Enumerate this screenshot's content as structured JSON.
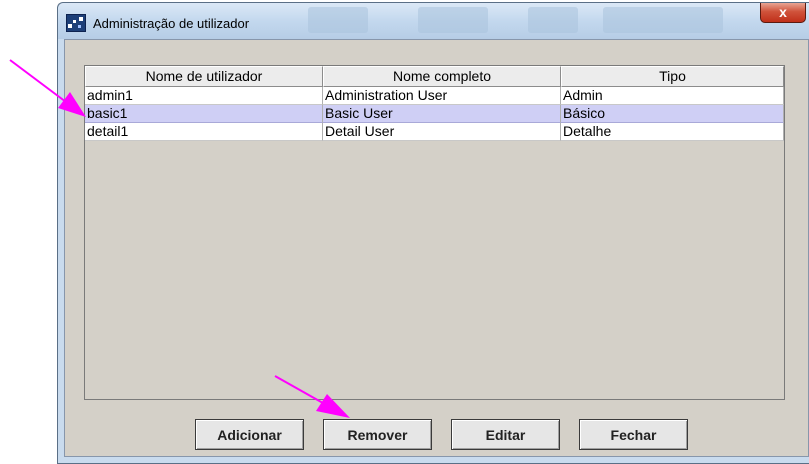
{
  "window": {
    "title": "Administração de utilizador",
    "close_glyph": "x"
  },
  "table": {
    "columns": [
      "Nome de utilizador",
      "Nome completo",
      "Tipo"
    ],
    "rows": [
      {
        "username": "admin1",
        "fullname": "Administration User",
        "type": "Admin"
      },
      {
        "username": "basic1",
        "fullname": "Basic User",
        "type": "Básico"
      },
      {
        "username": "detail1",
        "fullname": "Detail User",
        "type": "Detalhe"
      }
    ],
    "selected_row": 1
  },
  "buttons": {
    "add": "Adicionar",
    "remove": "Remover",
    "edit": "Editar",
    "close": "Fechar"
  },
  "annotations": {
    "arrow_color": "#ff00ff",
    "icons": [
      "app-icon",
      "close-icon"
    ]
  }
}
